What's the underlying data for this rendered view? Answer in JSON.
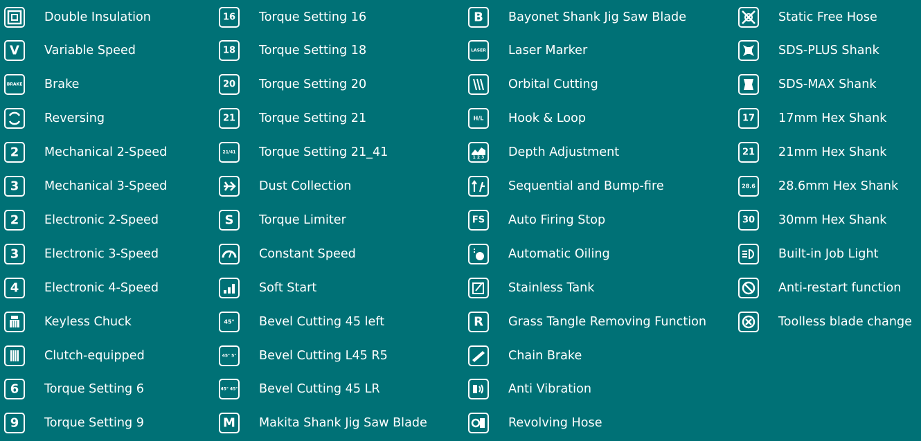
{
  "background_color": "#007176",
  "columns": [
    [
      {
        "label": "Double Insulation",
        "icon": "double-insulation-icon",
        "glyph": "sq"
      },
      {
        "label": "Variable Speed",
        "icon": "variable-speed-icon",
        "glyph": "V"
      },
      {
        "label": "Brake",
        "icon": "brake-icon",
        "glyph": "BRAKE"
      },
      {
        "label": "Reversing",
        "icon": "reversing-icon",
        "glyph": "rev"
      },
      {
        "label": "Mechanical 2-Speed",
        "icon": "mechanical-2-speed-icon",
        "glyph": "2"
      },
      {
        "label": "Mechanical 3-Speed",
        "icon": "mechanical-3-speed-icon",
        "glyph": "3"
      },
      {
        "label": "Electronic 2-Speed",
        "icon": "electronic-2-speed-icon",
        "glyph": "2"
      },
      {
        "label": "Electronic 3-Speed",
        "icon": "electronic-3-speed-icon",
        "glyph": "3"
      },
      {
        "label": "Electronic 4-Speed",
        "icon": "electronic-4-speed-icon",
        "glyph": "4"
      },
      {
        "label": "Keyless Chuck",
        "icon": "keyless-chuck-icon",
        "glyph": "chuck"
      },
      {
        "label": "Clutch-equipped",
        "icon": "clutch-icon",
        "glyph": "clutch"
      },
      {
        "label": "Torque Setting 6",
        "icon": "torque-setting-6-icon",
        "glyph": "6"
      },
      {
        "label": "Torque Setting 9",
        "icon": "torque-setting-9-icon",
        "glyph": "9"
      }
    ],
    [
      {
        "label": "Torque Setting 16",
        "icon": "torque-setting-16-icon",
        "glyph": "16"
      },
      {
        "label": "Torque Setting 18",
        "icon": "torque-setting-18-icon",
        "glyph": "18"
      },
      {
        "label": "Torque Setting 20",
        "icon": "torque-setting-20-icon",
        "glyph": "20"
      },
      {
        "label": "Torque Setting 21",
        "icon": "torque-setting-21-icon",
        "glyph": "21"
      },
      {
        "label": "Torque Setting 21_41",
        "icon": "torque-setting-21-41-icon",
        "glyph": "21/41"
      },
      {
        "label": "Dust Collection",
        "icon": "dust-collection-icon",
        "glyph": "dust"
      },
      {
        "label": "Torque Limiter",
        "icon": "torque-limiter-icon",
        "glyph": "S"
      },
      {
        "label": "Constant Speed",
        "icon": "constant-speed-icon",
        "glyph": "gauge"
      },
      {
        "label": "Soft Start",
        "icon": "soft-start-icon",
        "glyph": "bars"
      },
      {
        "label": "Bevel Cutting 45 left",
        "icon": "bevel-45-left-icon",
        "glyph": "45°"
      },
      {
        "label": "Bevel Cutting L45 R5",
        "icon": "bevel-l45-r5-icon",
        "glyph": "45° 5°"
      },
      {
        "label": "Bevel Cutting 45 LR",
        "icon": "bevel-45-lr-icon",
        "glyph": "45° 45°"
      },
      {
        "label": "Makita Shank Jig Saw Blade",
        "icon": "makita-shank-blade-icon",
        "glyph": "M"
      }
    ],
    [
      {
        "label": "Bayonet Shank Jig Saw Blade",
        "icon": "bayonet-shank-blade-icon",
        "glyph": "B"
      },
      {
        "label": "Laser Marker",
        "icon": "laser-marker-icon",
        "glyph": "LASER"
      },
      {
        "label": "Orbital Cutting",
        "icon": "orbital-cutting-icon",
        "glyph": "orbital"
      },
      {
        "label": "Hook & Loop",
        "icon": "hook-and-loop-icon",
        "glyph": "H/L"
      },
      {
        "label": "Depth Adjustment",
        "icon": "depth-adjustment-icon",
        "glyph": "123"
      },
      {
        "label": "Sequential and Bump-fire",
        "icon": "sequential-bump-fire-icon",
        "glyph": "fire"
      },
      {
        "label": "Auto Firing Stop",
        "icon": "auto-firing-stop-icon",
        "glyph": "FS"
      },
      {
        "label": "Automatic Oiling",
        "icon": "automatic-oiling-icon",
        "glyph": "oil"
      },
      {
        "label": "Stainless Tank",
        "icon": "stainless-tank-icon",
        "glyph": "tank"
      },
      {
        "label": "Grass Tangle Removing Function",
        "icon": "grass-tangle-removing-icon",
        "glyph": "R"
      },
      {
        "label": "Chain Brake",
        "icon": "chain-brake-icon",
        "glyph": "chain"
      },
      {
        "label": "Anti Vibration",
        "icon": "anti-vibration-icon",
        "glyph": "vib"
      },
      {
        "label": "Revolving Hose",
        "icon": "revolving-hose-icon",
        "glyph": "hose"
      }
    ],
    [
      {
        "label": "Static Free Hose",
        "icon": "static-free-hose-icon",
        "glyph": "x"
      },
      {
        "label": "SDS-PLUS Shank",
        "icon": "sds-plus-shank-icon",
        "glyph": "plus"
      },
      {
        "label": "SDS-MAX Shank",
        "icon": "sds-max-shank-icon",
        "glyph": "max"
      },
      {
        "label": "17mm Hex Shank",
        "icon": "hex-17mm-shank-icon",
        "glyph": "17"
      },
      {
        "label": "21mm Hex Shank",
        "icon": "hex-21mm-shank-icon",
        "glyph": "21"
      },
      {
        "label": "28.6mm Hex Shank",
        "icon": "hex-28-6mm-shank-icon",
        "glyph": "28.6"
      },
      {
        "label": "30mm Hex Shank",
        "icon": "hex-30mm-shank-icon",
        "glyph": "30"
      },
      {
        "label": "Built-in Job Light",
        "icon": "job-light-icon",
        "glyph": "light"
      },
      {
        "label": "Anti-restart function",
        "icon": "anti-restart-icon",
        "glyph": "restart"
      },
      {
        "label": "Toolless blade change",
        "icon": "toolless-blade-change-icon",
        "glyph": "toolless"
      }
    ]
  ]
}
